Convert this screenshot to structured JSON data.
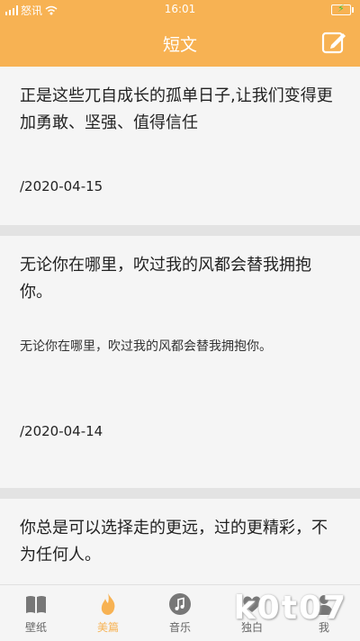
{
  "status_bar": {
    "carrier": "怒讯",
    "time": "16:01"
  },
  "app_bar": {
    "title": "短文"
  },
  "posts": [
    {
      "headline": "正是这些兀自成长的孤单日子,让我们变得更加勇敢、坚强、值得信任",
      "body": "",
      "date": "/2020-04-15"
    },
    {
      "headline": "无论你在哪里，吹过我的风都会替我拥抱你。",
      "body": "无论你在哪里，吹过我的风都会替我拥抱你。",
      "date": "/2020-04-14"
    },
    {
      "headline": "你总是可以选择走的更远，过的更精彩，不为任何人。",
      "body": "",
      "date": ""
    }
  ],
  "tabs": [
    {
      "label": "壁纸",
      "icon": "book-icon",
      "active": false
    },
    {
      "label": "美篇",
      "icon": "flame-icon",
      "active": true
    },
    {
      "label": "音乐",
      "icon": "music-note-icon",
      "active": false
    },
    {
      "label": "独白",
      "icon": "heart-icon",
      "active": false
    },
    {
      "label": "我",
      "icon": "person-icon",
      "active": false
    }
  ],
  "watermark": "k0t07",
  "colors": {
    "accent": "#f7b253",
    "card": "#f5f5f5",
    "background": "#e3e3e3"
  }
}
